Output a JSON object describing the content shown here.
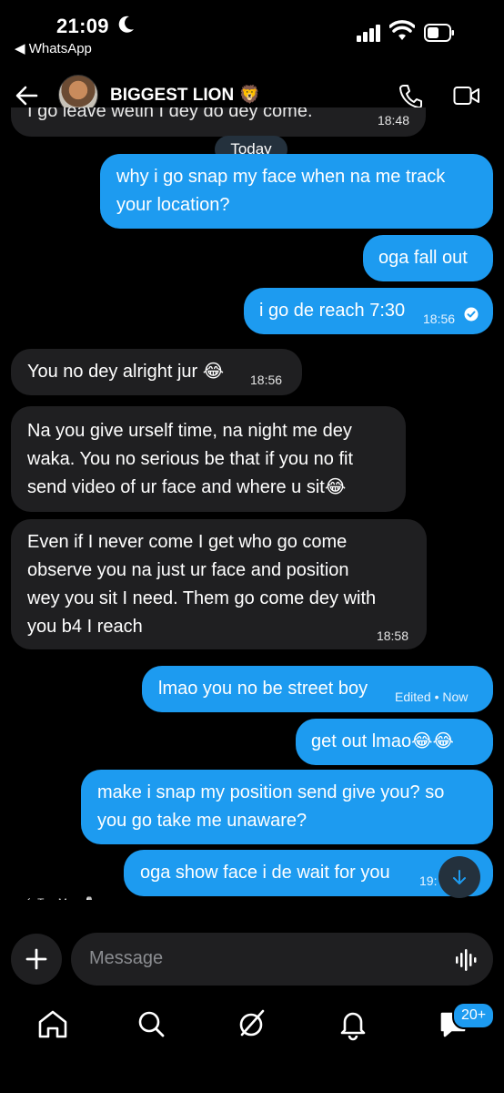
{
  "status_bar": {
    "time": "21:09",
    "back_app": "◀ WhatsApp"
  },
  "header": {
    "name": "BIGGEST LION",
    "name_emoji": "🦁"
  },
  "chat": {
    "cut_top_text": "I go leave wetin I dey do dey come.",
    "cut_top_time": "18:48",
    "day_label": "Today",
    "messages": [
      {
        "lines": [
          "why i go snap my face when na me track",
          "your location?"
        ],
        "time": ""
      },
      {
        "lines": [
          "oga fall out"
        ],
        "time": ""
      },
      {
        "lines": [
          "i go de reach 7:30"
        ],
        "time": "18:56"
      },
      {
        "lines": [
          "You no dey alright jur 😂"
        ],
        "time": "18:56"
      },
      {
        "lines": [
          "Na you give urself time, na night me dey",
          "waka. You no serious be that if you no fit",
          "send video of ur face and where u sit😂"
        ],
        "time": ""
      },
      {
        "lines": [
          "Even if I never come I get who go come",
          "observe you na just ur face and position",
          "wey you sit I need. Them go come dey with",
          "you b4 I reach"
        ],
        "time": "18:58"
      },
      {
        "lines": [
          "lmao you no be street boy"
        ],
        "time": "Edited • Now"
      },
      {
        "lines": [
          "get out lmao😂😂"
        ],
        "time": ""
      },
      {
        "lines": [
          "make i snap my position send give you? so",
          "you go take me unaware?"
        ],
        "time": ""
      },
      {
        "lines": [
          "oga show face i de wait for you"
        ],
        "time": "19:"
      }
    ],
    "reply_hint": "↰ Ten Man 🍷"
  },
  "composer": {
    "placeholder": "Message"
  },
  "tabs": {
    "badge": "20+",
    "items": [
      "home-icon",
      "search-icon",
      "grok-icon",
      "notifications-icon",
      "messages-icon"
    ]
  },
  "colors": {
    "outgoing": "#1d9bf0",
    "incoming": "#1f1f21",
    "background": "#000000"
  }
}
